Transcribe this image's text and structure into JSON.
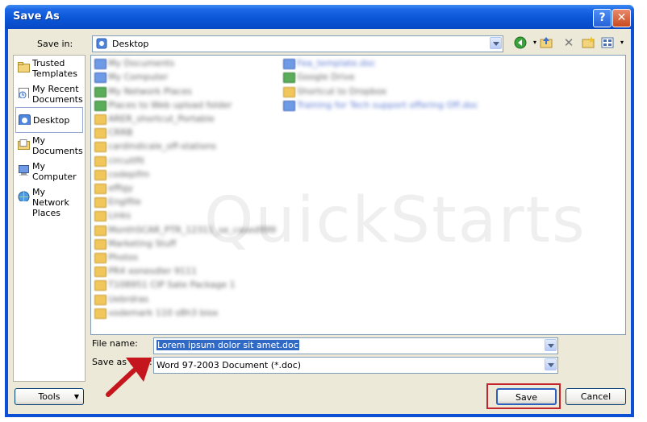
{
  "window": {
    "title": "Save As"
  },
  "titlebar": {
    "help_glyph": "?",
    "close_glyph": "✕"
  },
  "save_in": {
    "label": "Save in:",
    "value": "Desktop"
  },
  "places": [
    {
      "label": "Trusted Templates",
      "icon": "folder-icon"
    },
    {
      "label": "My Recent Documents",
      "icon": "recent-documents-icon"
    },
    {
      "label": "Desktop",
      "icon": "desktop-icon",
      "selected": true
    },
    {
      "label": "My Documents",
      "icon": "my-documents-icon"
    },
    {
      "label": "My Computer",
      "icon": "my-computer-icon"
    },
    {
      "label": "My Network Places",
      "icon": "network-places-icon"
    }
  ],
  "file_name": {
    "label": "File name:",
    "value": "Lorem ipsum dolor sit amet.doc"
  },
  "save_type": {
    "label": "Save as type:",
    "value": "Word 97-2003 Document (*.doc)"
  },
  "buttons": {
    "tools": "Tools",
    "save": "Save",
    "cancel": "Cancel"
  },
  "colors": {
    "titlebar": "#0a56d8",
    "dialog_bg": "#ece9d8",
    "highlight": "#c4242b"
  },
  "annotation": {
    "watermark": "QuickStarts"
  }
}
